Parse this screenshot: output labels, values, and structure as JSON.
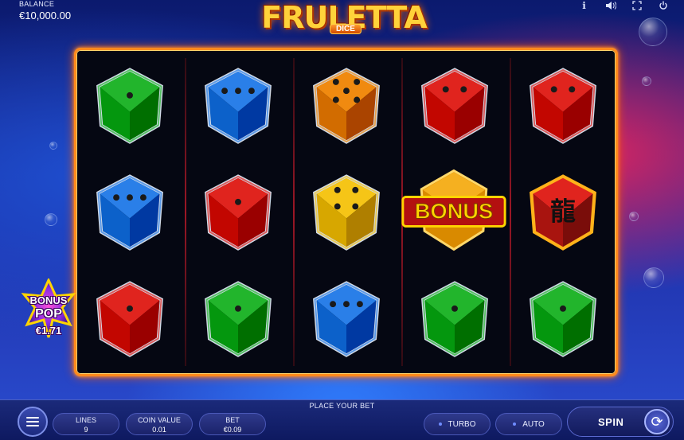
{
  "balance": {
    "label": "BALANCE",
    "value": "€10,000.00"
  },
  "logo": {
    "title": "FRULETTA",
    "subtitle": "DICE"
  },
  "top_icons": [
    "info-icon",
    "sound-icon",
    "fullscreen-icon",
    "power-icon"
  ],
  "reels": {
    "grid": [
      [
        {
          "type": "die",
          "color": "green",
          "pips": 1
        },
        {
          "type": "die",
          "color": "blue",
          "pips": 3
        },
        {
          "type": "die",
          "color": "red",
          "pips": 1
        }
      ],
      [
        {
          "type": "die",
          "color": "blue",
          "pips": 3
        },
        {
          "type": "die",
          "color": "red",
          "pips": 1
        },
        {
          "type": "die",
          "color": "green",
          "pips": 1
        }
      ],
      [
        {
          "type": "die",
          "color": "orange",
          "pips": 5
        },
        {
          "type": "die",
          "color": "yellow",
          "pips": 4
        },
        {
          "type": "die",
          "color": "blue",
          "pips": 3
        }
      ],
      [
        {
          "type": "die",
          "color": "red",
          "pips": 2
        },
        {
          "type": "bonus",
          "label": "BONUS"
        },
        {
          "type": "die",
          "color": "green",
          "pips": 1
        }
      ],
      [
        {
          "type": "die",
          "color": "red",
          "pips": 2
        },
        {
          "type": "dragon",
          "glyph": "龍"
        },
        {
          "type": "die",
          "color": "green",
          "pips": 1
        }
      ]
    ],
    "colors": {
      "green": "#22b52c",
      "blue": "#2a7fe8",
      "red": "#e0241e",
      "orange": "#f08a10",
      "yellow": "#f5c517"
    }
  },
  "bonus_pop": {
    "line1": "BONUS",
    "line2": "POP",
    "amount": "€1.71"
  },
  "bottom": {
    "status": "PLACE YOUR BET",
    "lines": {
      "label": "LINES",
      "value": "9"
    },
    "coin_value": {
      "label": "COIN VALUE",
      "value": "0.01"
    },
    "bet": {
      "label": "BET",
      "value": "€0.09"
    },
    "turbo": "TURBO",
    "auto": "AUTO",
    "spin": "SPIN"
  }
}
